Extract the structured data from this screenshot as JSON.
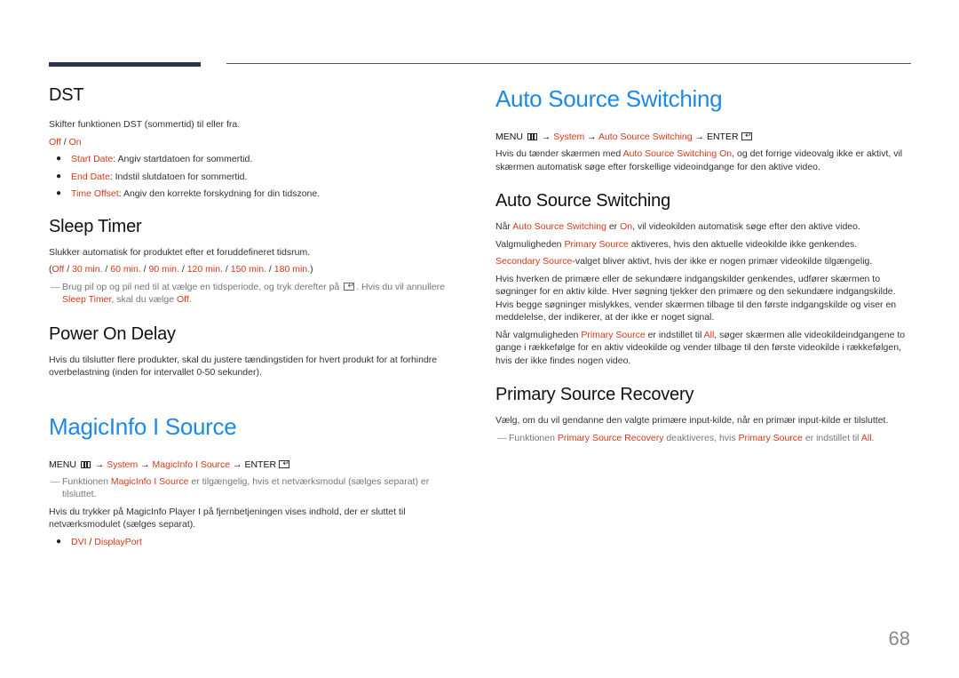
{
  "page_number": "68",
  "colors": {
    "accent_blue": "#1e88e5",
    "highlight_red": "#d4381a",
    "rule_dark": "#2b3346"
  },
  "left": {
    "dst": {
      "title": "DST",
      "desc": "Skifter funktionen DST (sommertid) til eller fra.",
      "options": {
        "off": "Off",
        "sep": " / ",
        "on": "On"
      },
      "bullets": [
        {
          "term": "Start Date",
          "text": ": Angiv startdatoen for sommertid."
        },
        {
          "term": "End Date",
          "text": ": Indstil slutdatoen for sommertid."
        },
        {
          "term": "Time Offset",
          "text": ": Angiv den korrekte forskydning for din tidszone."
        }
      ]
    },
    "sleep_timer": {
      "title": "Sleep Timer",
      "desc": "Slukker automatisk for produktet efter et foruddefineret tidsrum.",
      "options_open": "(",
      "options": [
        "Off",
        "30 min.",
        "60 min.",
        "90 min.",
        "120 min.",
        "150 min.",
        "180 min."
      ],
      "sep": " / ",
      "options_close": ")",
      "note_a": "Brug pil op og pil ned til at vælge en tidsperiode, og tryk derefter på ",
      "note_b": ". Hvis du vil annullere ",
      "note_term": "Sleep Timer",
      "note_c": ", skal du vælge ",
      "note_off": "Off",
      "note_end": "."
    },
    "power_on_delay": {
      "title": "Power On Delay",
      "desc": "Hvis du tilslutter flere produkter, skal du justere tændingstiden for hvert produkt for at forhindre overbelastning (inden for intervallet 0-50 sekunder)."
    },
    "magicinfo": {
      "title": "MagicInfo I Source",
      "menu": {
        "menu": "MENU",
        "arrow": " → ",
        "system": "System",
        "item": "MagicInfo I Source",
        "enter": "ENTER"
      },
      "note_a": "Funktionen ",
      "note_term": "MagicInfo I Source",
      "note_b": " er tilgængelig, hvis et netværksmodul (sælges separat) er tilsluttet.",
      "desc": "Hvis du trykker på MagicInfo Player I på fjernbetjeningen vises indhold, der er sluttet til netværksmodulet (sælges separat).",
      "bullet": {
        "a": "DVI",
        "sep": " / ",
        "b": "DisplayPort"
      }
    }
  },
  "right": {
    "auto_source": {
      "title": "Auto Source Switching",
      "menu": {
        "menu": "MENU",
        "arrow": " → ",
        "system": "System",
        "item": "Auto Source Switching",
        "enter": "ENTER"
      },
      "desc_a": "Hvis du tænder skærmen med ",
      "desc_term": "Auto Source Switching On",
      "desc_b": ", og det forrige videovalg ikke er aktivt, vil skærmen automatisk søge efter forskellige videoindgange for den aktive video."
    },
    "auto_source_sub": {
      "title": "Auto Source Switching",
      "p1_a": "Når ",
      "p1_term": "Auto Source Switching",
      "p1_b": " er ",
      "p1_on": "On",
      "p1_c": ", vil videokilden automatisk søge efter den aktive video.",
      "p2_a": "Valgmuligheden ",
      "p2_term": "Primary Source",
      "p2_b": " aktiveres, hvis den aktuelle videokilde ikke genkendes.",
      "p3_term": "Secondary Source",
      "p3_b": "-valget bliver aktivt, hvis der ikke er nogen primær videokilde tilgængelig.",
      "p4": "Hvis hverken de primære eller de sekundære indgangskilder genkendes, udfører skærmen to søgninger for en aktiv kilde. Hver søgning tjekker den primære og den sekundære indgangskilde. Hvis begge søgninger mislykkes, vender skærmen tilbage til den første indgangskilde og viser en meddelelse, der indikerer, at der ikke er noget signal.",
      "p5_a": "Når valgmuligheden ",
      "p5_term": "Primary Source",
      "p5_b": " er indstillet til ",
      "p5_all": "All",
      "p5_c": ", søger skærmen alle videokildeindgangene to gange i rækkefølge for en aktiv videokilde og vender tilbage til den første videokilde i rækkefølgen, hvis der ikke findes nogen video."
    },
    "primary_recovery": {
      "title": "Primary Source Recovery",
      "desc": "Vælg, om du vil gendanne den valgte primære input-kilde, når en primær input-kilde er tilsluttet.",
      "note_a": "Funktionen ",
      "note_term": "Primary Source Recovery",
      "note_b": " deaktiveres, hvis ",
      "note_term2": "Primary Source",
      "note_c": " er indstillet til ",
      "note_all": "All",
      "note_end": "."
    }
  }
}
